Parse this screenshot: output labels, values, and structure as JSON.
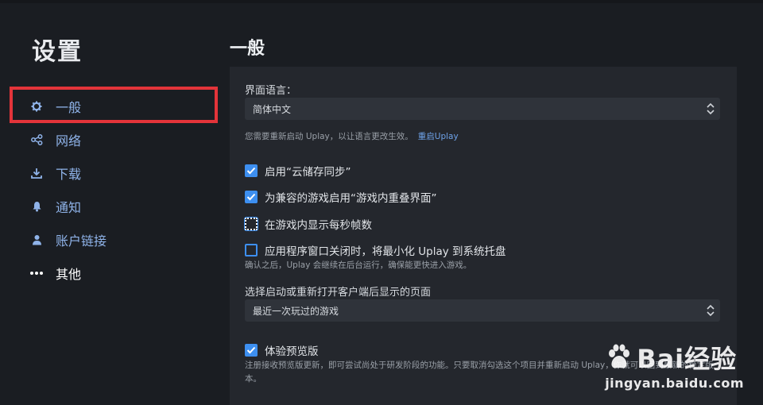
{
  "sidebar": {
    "title": "设置",
    "items": [
      {
        "label": "一般",
        "icon": "gear-icon"
      },
      {
        "label": "网络",
        "icon": "network-icon"
      },
      {
        "label": "下载",
        "icon": "download-icon"
      },
      {
        "label": "通知",
        "icon": "bell-icon"
      },
      {
        "label": "账户链接",
        "icon": "user-icon"
      },
      {
        "label": "其他",
        "icon": "more-icon"
      }
    ]
  },
  "main": {
    "title": "一般",
    "language": {
      "label": "界面语言：",
      "value": "简体中文",
      "hint": "您需要重新启动 Uplay，以让语言更改生效。",
      "restart_link": "重启Uplay"
    },
    "options": [
      {
        "label": "启用“云储存同步”",
        "checked": true
      },
      {
        "label": "为兼容的游戏启用“游戏内重叠界面”",
        "checked": true
      },
      {
        "label": "在游戏内显示每秒帧数",
        "checked": false
      },
      {
        "label": "应用程序窗口关闭时，将最小化 Uplay 到系统托盘",
        "checked": false,
        "description": "确认之后，Uplay 会继续在后台运行，确保能更快进入游戏。"
      }
    ],
    "start_page": {
      "label": "选择启动或重新打开客户端后显示的页面",
      "value": "最近一次玩过的游戏"
    },
    "beta": {
      "label": "体验预览版",
      "checked": true,
      "description": "注册接收预览版更新，即可尝试尚处于研发阶段的功能。只要取消勾选这个项目并重新启动 Uplay，你就可以回到最新的稳定版本。"
    }
  },
  "watermark": {
    "brand": "Bai经验",
    "url": "jingyan.baidu.com"
  },
  "colors": {
    "accent": "#3d8ff0",
    "link": "#6ea2e8",
    "highlight_box": "#e3343a",
    "nav_text": "#8fb3e9"
  }
}
